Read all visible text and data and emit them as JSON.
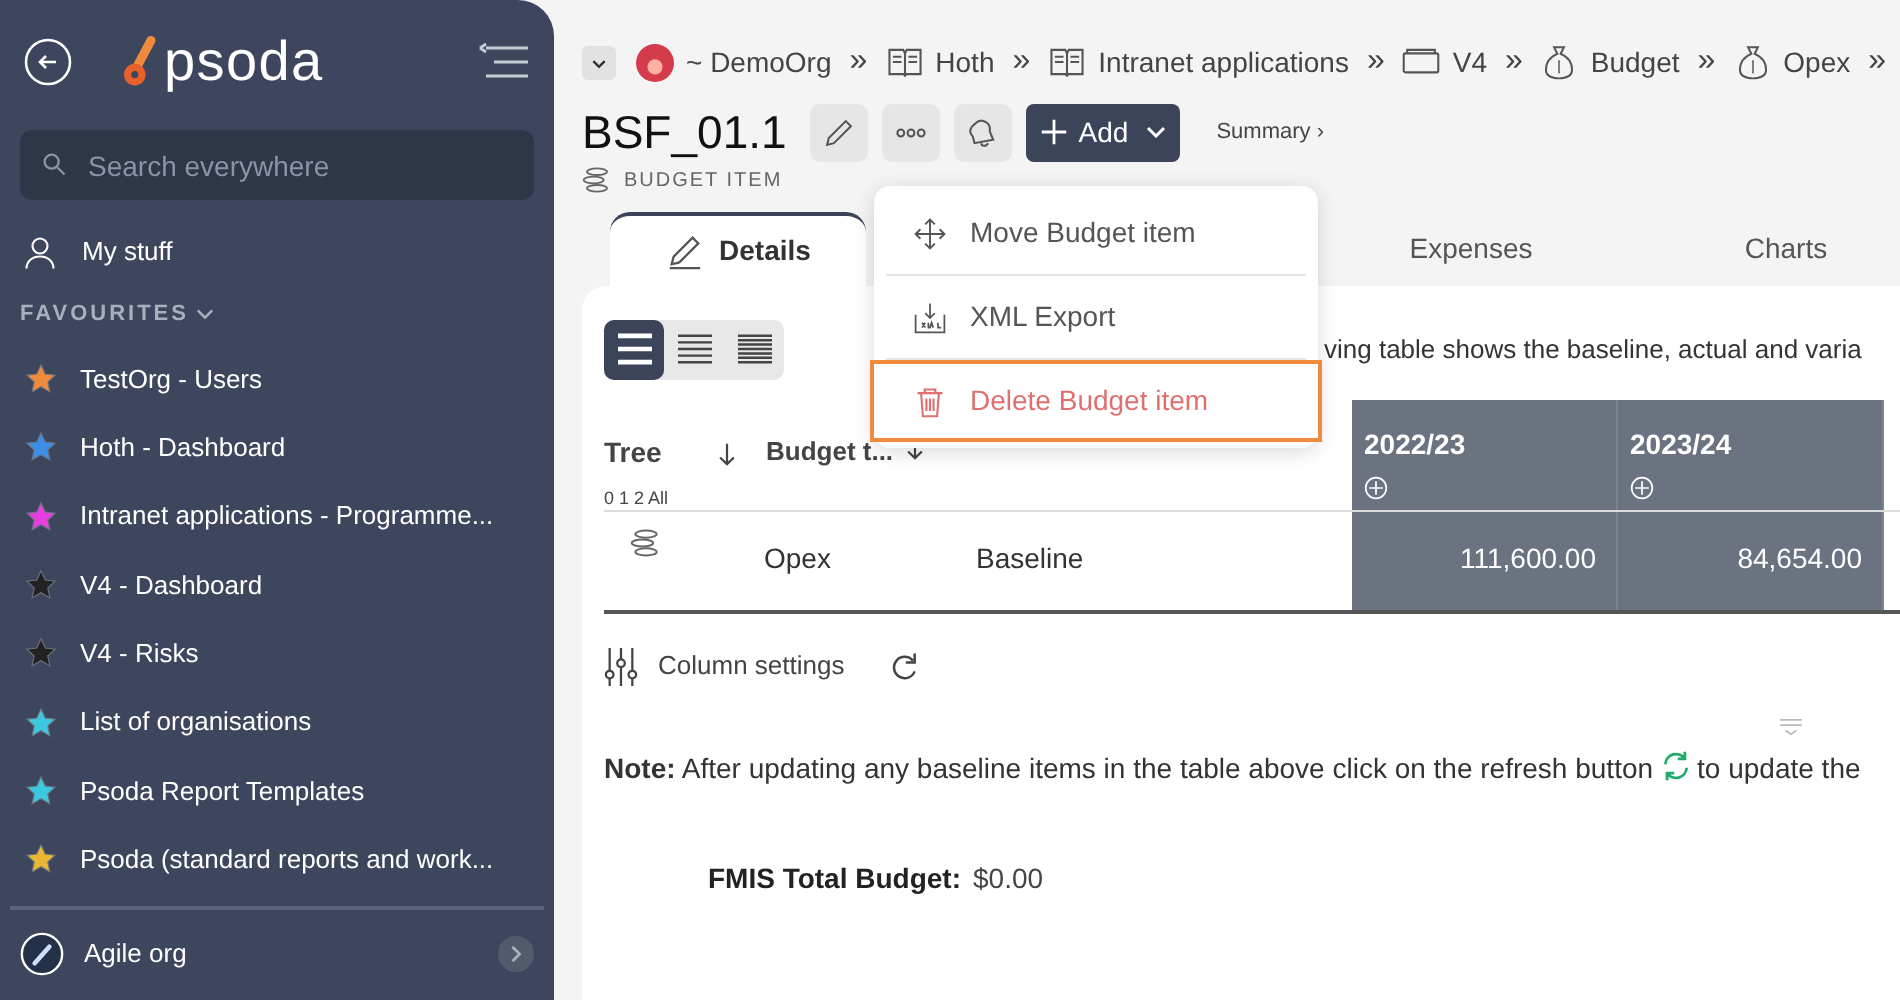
{
  "sidebar": {
    "brand": "psoda",
    "search": {
      "placeholder": "Search everywhere"
    },
    "my_stuff": "My stuff",
    "favourites_label": "FAVOURITES",
    "favourites": [
      {
        "label": "TestOrg - Users",
        "color": "#f08a3c"
      },
      {
        "label": "Hoth - Dashboard",
        "color": "#3b8fe8"
      },
      {
        "label": "Intranet applications - Programme...",
        "color": "#e83ee0"
      },
      {
        "label": "V4 - Dashboard",
        "color": "#222222"
      },
      {
        "label": "V4 - Risks",
        "color": "#222222"
      },
      {
        "label": "List of organisations",
        "color": "#3cc8e0"
      },
      {
        "label": "Psoda Report Templates",
        "color": "#3cc8e0"
      },
      {
        "label": "Psoda (standard reports and work...",
        "color": "#e8b830"
      }
    ],
    "org": "Agile org"
  },
  "breadcrumb": [
    {
      "label": "~ DemoOrg",
      "kind": "org"
    },
    {
      "label": "Hoth",
      "kind": "book"
    },
    {
      "label": "Intranet applications",
      "kind": "book"
    },
    {
      "label": "V4",
      "kind": "folder"
    },
    {
      "label": "Budget",
      "kind": "money"
    },
    {
      "label": "Opex",
      "kind": "money"
    }
  ],
  "breadcrumb_separator": "»",
  "title": "BSF_01.1",
  "subtitle": "BUDGET ITEM",
  "add_button": "Add",
  "summary_link": "Summary ›",
  "tabs": [
    {
      "label": "Details",
      "selected": true
    },
    {
      "label": "Expenses",
      "selected": false
    },
    {
      "label": "Charts",
      "selected": false
    }
  ],
  "menu": [
    {
      "label": "Move Budget item",
      "kind": "move",
      "highlighted": false
    },
    {
      "label": "XML Export",
      "kind": "export",
      "highlighted": false
    },
    {
      "label": "Delete Budget item",
      "kind": "delete",
      "highlighted": true
    }
  ],
  "density": [
    {
      "selected": true
    },
    {
      "selected": false
    },
    {
      "selected": false
    }
  ],
  "description": "ving table shows the baseline, actual and varia",
  "table": {
    "columns": [
      "Tree",
      "Budget t..."
    ],
    "tree_levels": "0 1 2 All",
    "years": [
      "2022/23",
      "2023/24"
    ],
    "rows": [
      {
        "name": "Opex",
        "type": "Baseline",
        "values": [
          "111,600.00",
          "84,654.00"
        ]
      }
    ]
  },
  "column_settings": "Column settings",
  "note": {
    "text": "**Note:** After updating any baseline items in the table above click on the refresh button",
    "after": "to update the"
  },
  "fmis": {
    "label": "FMIS Total Budget:",
    "value": "$0.00"
  }
}
